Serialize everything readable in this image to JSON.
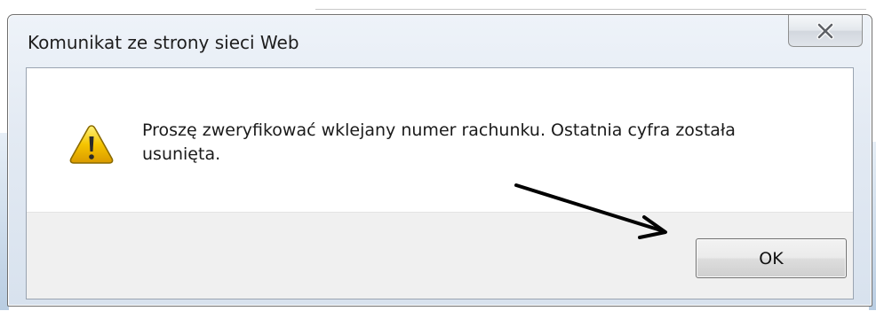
{
  "window": {
    "title": "Komunikat ze strony sieci Web"
  },
  "message": {
    "text": "Proszę zweryfikować wklejany numer rachunku. Ostatnia cyfra została usunięta.",
    "icon": "warning-icon"
  },
  "buttons": {
    "ok_label": "OK",
    "close_icon": "close-icon"
  },
  "colors": {
    "warning_fill": "#f5c400",
    "warning_outline": "#8a6a00",
    "annotation_arrow": "#000000"
  }
}
